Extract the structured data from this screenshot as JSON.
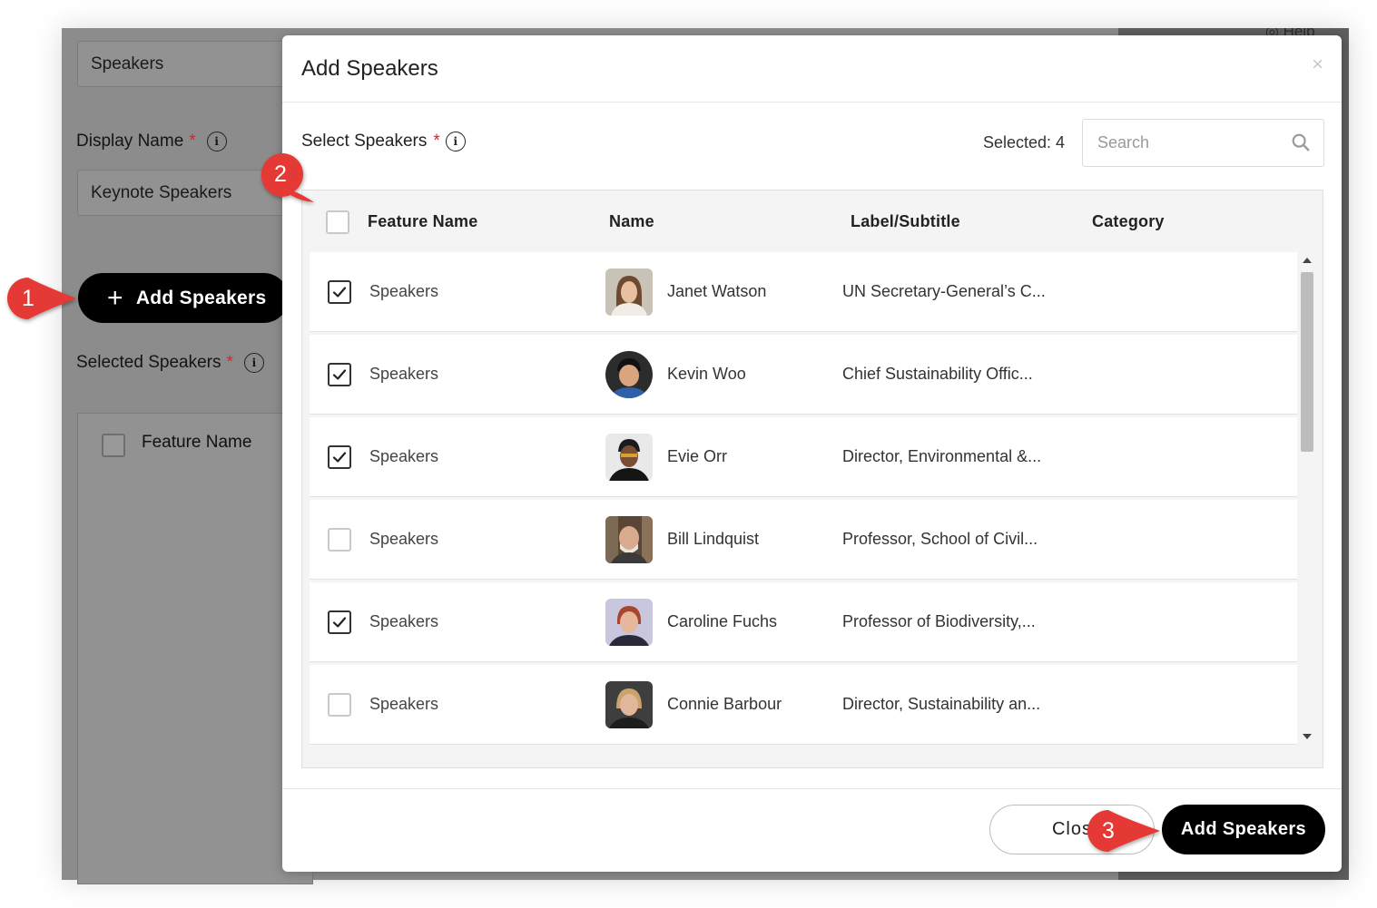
{
  "background": {
    "help_label": "Help",
    "top_field_value": "Speakers",
    "display_name_label": "Display Name",
    "required_mark": "*",
    "display_name_value": "Keynote Speakers",
    "add_button_label": "Add Speakers",
    "selected_speakers_label": "Selected Speakers",
    "table_header_feature": "Feature Name"
  },
  "modal": {
    "title": "Add Speakers",
    "close_symbol": "×",
    "select_label": "Select Speakers",
    "required_mark": "*",
    "selected_count": "Selected: 4",
    "search_placeholder": "Search",
    "columns": [
      "Feature Name",
      "Name",
      "Label/Subtitle",
      "Category"
    ],
    "rows": [
      {
        "feature": "Speakers",
        "name": "Janet Watson",
        "label": "UN Secretary-General’s C...",
        "checked": true
      },
      {
        "feature": "Speakers",
        "name": "Kevin Woo",
        "label": "Chief Sustainability Offic...",
        "checked": true
      },
      {
        "feature": "Speakers",
        "name": "Evie Orr",
        "label": "Director, Environmental &...",
        "checked": true
      },
      {
        "feature": "Speakers",
        "name": "Bill Lindquist",
        "label": "Professor, School of Civil...",
        "checked": false
      },
      {
        "feature": "Speakers",
        "name": "Caroline Fuchs",
        "label": "Professor of Biodiversity,...",
        "checked": true
      },
      {
        "feature": "Speakers",
        "name": "Connie Barbour",
        "label": "Director, Sustainability an...",
        "checked": false
      }
    ],
    "footer": {
      "close_label": "Clos",
      "add_label": "Add Speakers"
    }
  },
  "callouts": [
    "1",
    "2",
    "3"
  ],
  "colors": {
    "callout_red": "#e53935",
    "primary_button": "#000000",
    "overlay_gray": "#8c8c8c"
  }
}
